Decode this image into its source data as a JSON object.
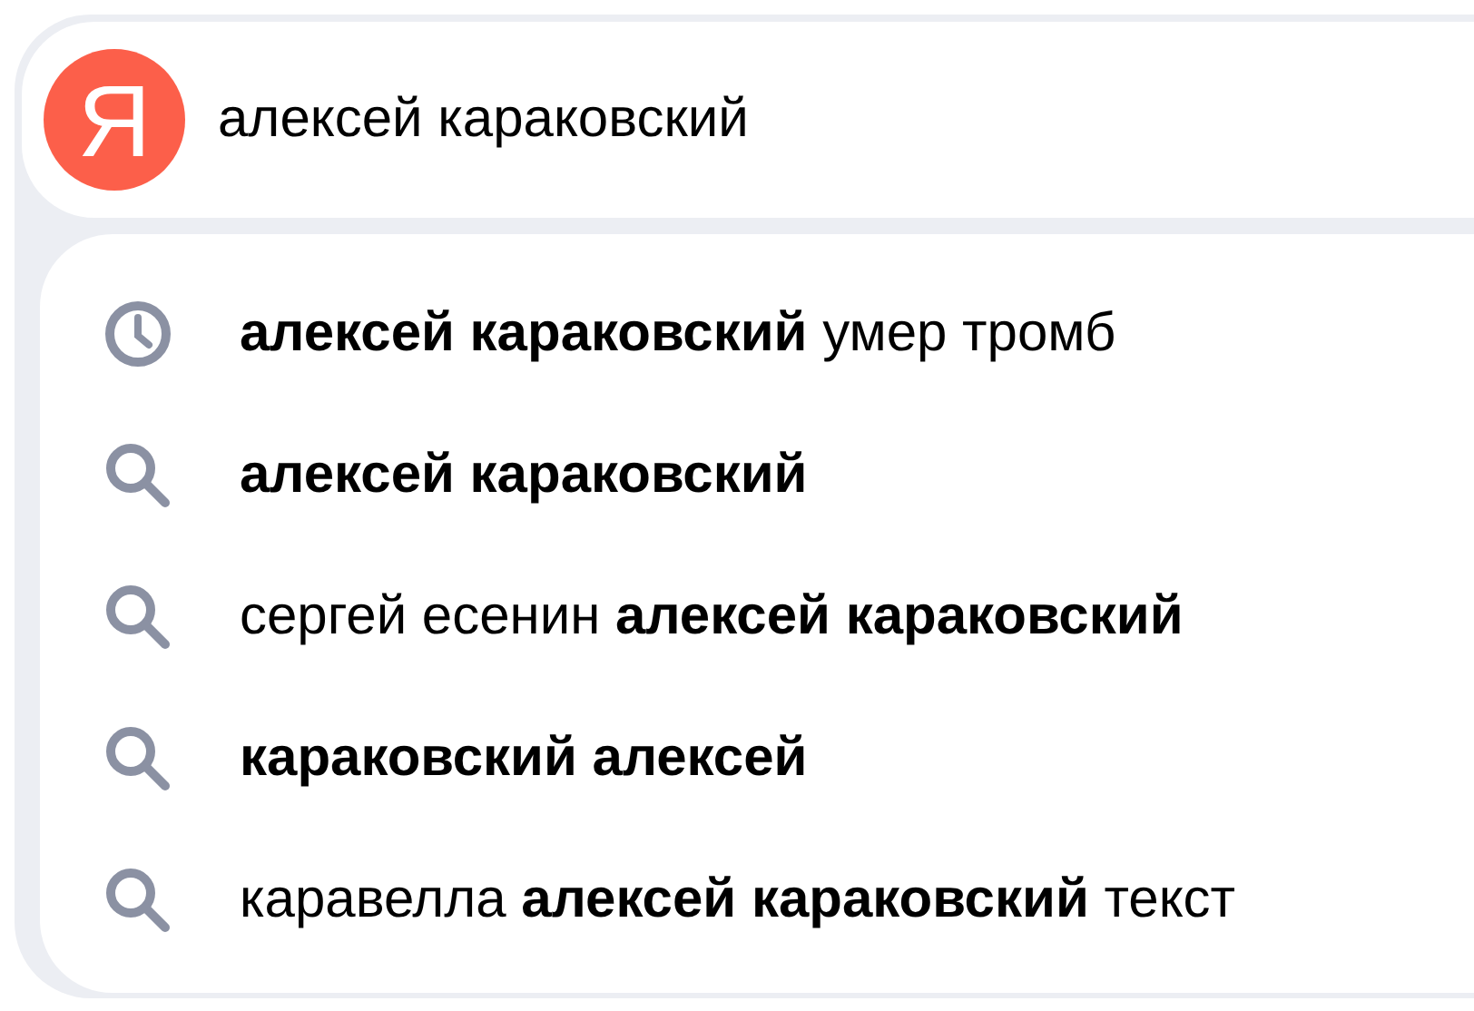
{
  "logo": "Я",
  "search": {
    "value": "алексей караковский"
  },
  "suggestions": [
    {
      "kind": "history",
      "bold": false,
      "text": "**алексей караковский** умер тромб"
    },
    {
      "kind": "search",
      "bold": true,
      "text": "алексей караковский"
    },
    {
      "kind": "search",
      "bold": false,
      "text": "сергей есенин **алексей караковский**"
    },
    {
      "kind": "search",
      "bold": true,
      "text": "караковский алексей"
    },
    {
      "kind": "search",
      "bold": false,
      "text": "каравелла **алексей караковский** текст"
    }
  ]
}
